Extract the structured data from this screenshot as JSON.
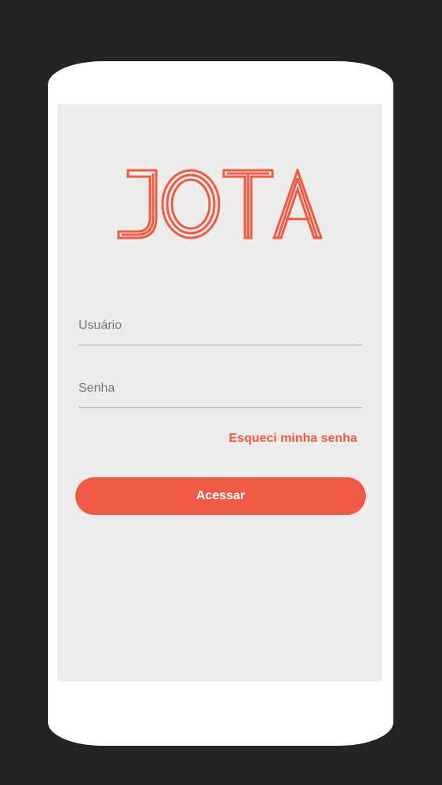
{
  "app": {
    "logo_text": "JOTA",
    "brand_color": "#f05a44"
  },
  "login": {
    "username_placeholder": "Usuário",
    "password_placeholder": "Senha",
    "forgot_label": "Esqueci minha senha",
    "submit_label": "Acessar"
  }
}
